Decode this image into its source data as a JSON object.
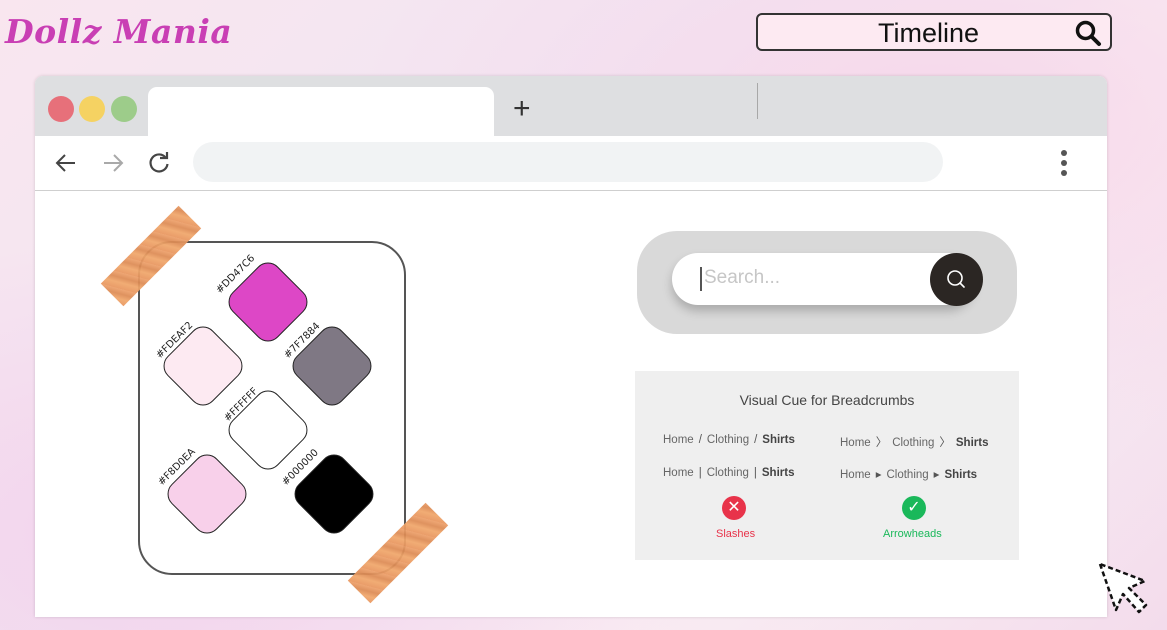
{
  "brand": {
    "title": "Dollz Mania"
  },
  "top_search": {
    "label": "Timeline",
    "icon": "search-icon"
  },
  "browser": {
    "traffic_lights": [
      "#e7707a",
      "#f5d262",
      "#9dcc8a"
    ],
    "new_tab_label": "+",
    "nav_icons": [
      "back-arrow-icon",
      "forward-arrow-icon",
      "reload-icon"
    ],
    "menu_icon": "kebab-menu-icon"
  },
  "palette": {
    "swatches": [
      {
        "hex": "#DD47C6",
        "color": "#dd47c6"
      },
      {
        "hex": "#FDEAF2",
        "color": "#fdeaf2"
      },
      {
        "hex": "#7F7884",
        "color": "#7f7884"
      },
      {
        "hex": "#FFFFFF",
        "color": "#ffffff"
      },
      {
        "hex": "#F8D0EA",
        "color": "#f8d0ea"
      },
      {
        "hex": "#000000",
        "color": "#000000"
      }
    ]
  },
  "search_widget": {
    "placeholder": "Search...",
    "icon": "search-icon"
  },
  "breadcrumbs": {
    "title": "Visual Cue for Breadcrumbs",
    "slash": {
      "home": "Home",
      "sep": "/",
      "mid": "Clothing",
      "last": "Shirts"
    },
    "chevron": {
      "home": "Home",
      "sep": "〉",
      "mid": "Clothing",
      "last": "Shirts"
    },
    "pipe": {
      "home": "Home",
      "sep": "|",
      "mid": "Clothing",
      "last": "Shirts"
    },
    "arrowhead": {
      "home": "Home",
      "sep": "▸",
      "mid": "Clothing",
      "last": "Shirts"
    },
    "bad": {
      "label": "Slashes",
      "mark": "✕",
      "color": "#e8334a"
    },
    "good": {
      "label": "Arrowheads",
      "mark": "✓",
      "color": "#1ab85a"
    }
  }
}
